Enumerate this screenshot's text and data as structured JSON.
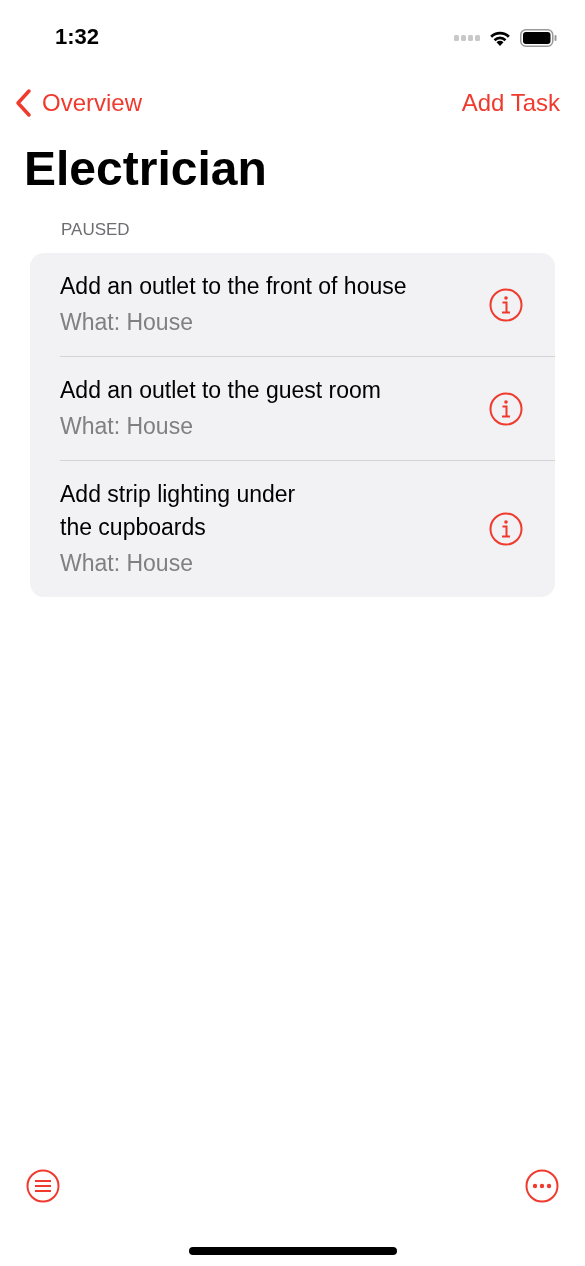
{
  "status_bar": {
    "time": "1:32"
  },
  "nav": {
    "back": "Overview",
    "action": "Add Task"
  },
  "title": "Electrician",
  "section": {
    "header": "PAUSED",
    "tasks": [
      {
        "title": "Add an outlet to the front of house",
        "subtitle": "What: House"
      },
      {
        "title": "Add an outlet to the guest room",
        "subtitle": "What: House"
      },
      {
        "title": "Add strip lighting under\nthe cupboards",
        "subtitle": "What: House"
      }
    ]
  }
}
